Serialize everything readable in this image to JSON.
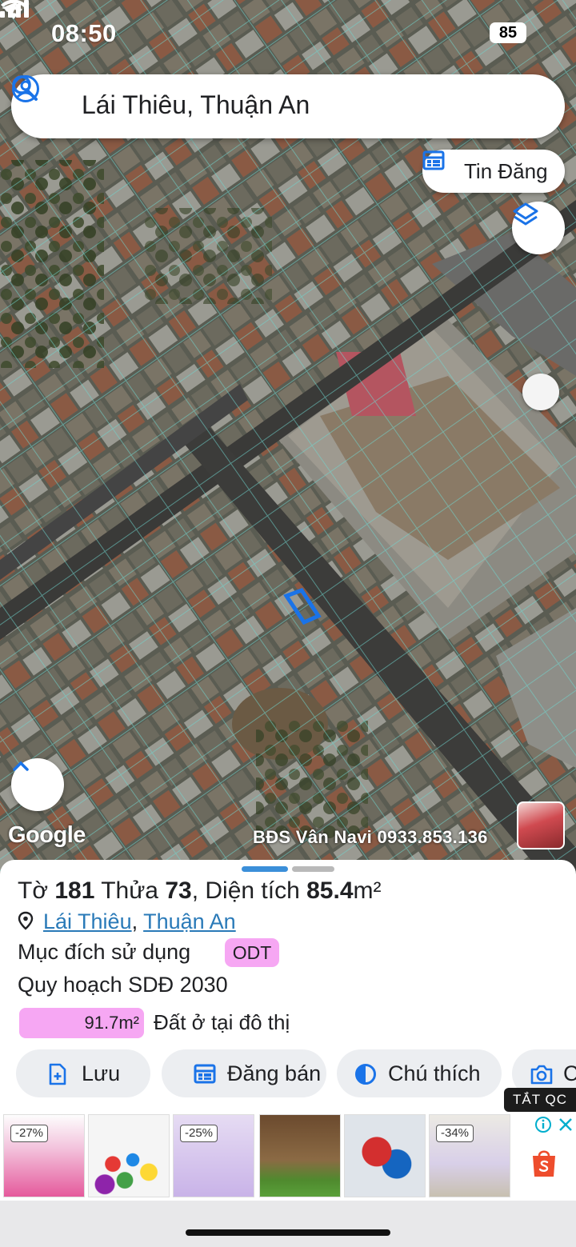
{
  "status_bar": {
    "time": "08:50",
    "battery": "85"
  },
  "search": {
    "query": "Lái Thiêu, Thuận An"
  },
  "map": {
    "tin_dang_label": "Tin Đăng",
    "watermark": "Google",
    "credit": "BĐS Vân Navi 0933.853.136"
  },
  "parcel": {
    "title_prefix": "Tờ",
    "sheet_no": "181",
    "plot_prefix": "Thửa",
    "plot_no": "73",
    "area_prefix": ", Diện tích",
    "area_value": "85.4",
    "area_unit": "m²",
    "ward": "Lái Thiêu",
    "district": "Thuận An",
    "purpose_label": "Mục đích sử dụng",
    "purpose_code": "ODT",
    "plan_label": "Quy hoạch SDĐ 2030",
    "plan_area": "91.7m²",
    "plan_type": "Đất ở tại đô thị"
  },
  "actions": [
    {
      "label": "Lưu",
      "icon": "add-file-icon"
    },
    {
      "label": "Đăng bán",
      "icon": "calendar-icon"
    },
    {
      "label": "Chú thích",
      "icon": "half-circle-icon"
    },
    {
      "label": "C",
      "icon": "camera-add-icon"
    }
  ],
  "ad": {
    "close_label": "TẮT QC",
    "items": [
      {
        "discount": "-27%"
      },
      {
        "discount": ""
      },
      {
        "discount": "-25%"
      },
      {
        "discount": ""
      },
      {
        "discount": ""
      },
      {
        "discount": "-34%"
      }
    ]
  },
  "colors": {
    "accent_blue": "#1a73e8",
    "badge_pink": "#f6a7f3",
    "link_blue": "#2a7ab8",
    "parcel_line": "#6fd6d0"
  }
}
